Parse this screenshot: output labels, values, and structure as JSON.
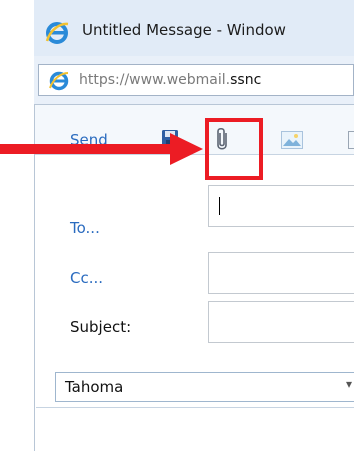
{
  "window": {
    "title": "Untitled Message - Window",
    "address_prefix": "https://www.webmail.",
    "address_domain": "ssnc"
  },
  "toolbar": {
    "send_label": "Send",
    "icons": [
      "save-icon",
      "attach-icon",
      "image-icon"
    ]
  },
  "fields": {
    "to_label": "To...",
    "cc_label": "Cc...",
    "subject_label": "Subject:"
  },
  "format": {
    "font_name": "Tahoma"
  },
  "colors": {
    "link_blue": "#2a6bbf",
    "highlight_red": "#ec1c24"
  }
}
